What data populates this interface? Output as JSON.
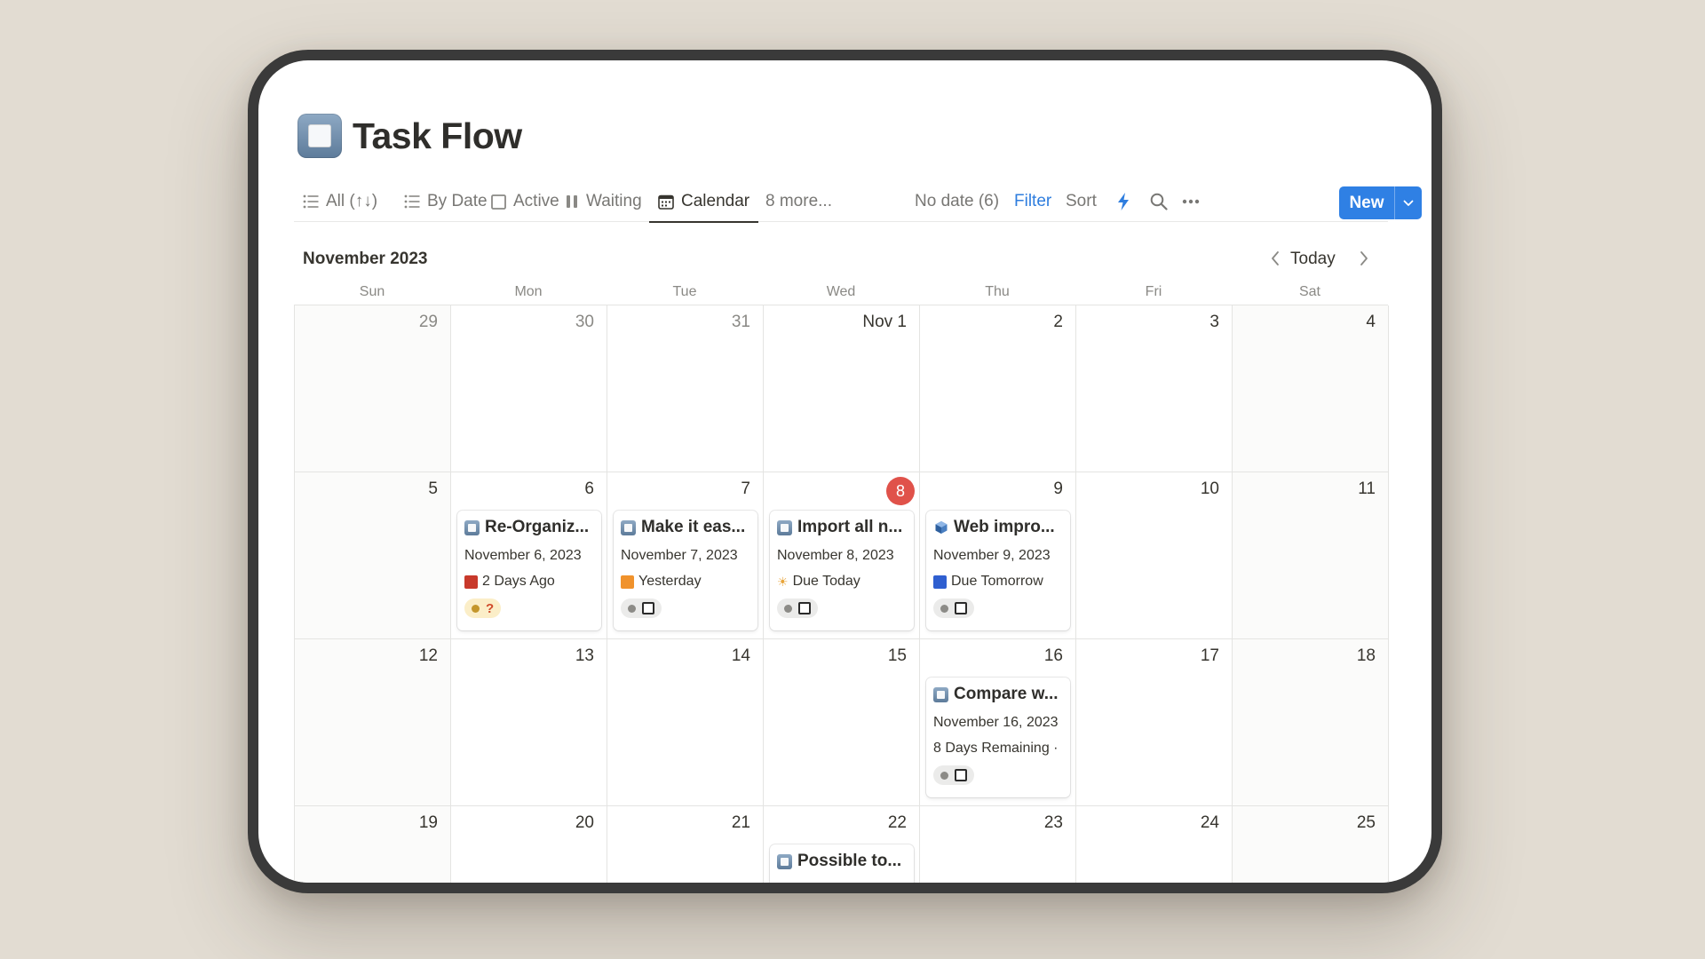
{
  "page": {
    "title": "Task Flow",
    "icon": "stop-button-icon"
  },
  "views": [
    {
      "label": "All (↑↓)",
      "icon": "list-icon"
    },
    {
      "label": "By Date",
      "icon": "list-icon"
    },
    {
      "label": "Active",
      "icon": "checkbox-icon"
    },
    {
      "label": "Waiting",
      "icon": "pause-icon"
    },
    {
      "label": "Calendar",
      "icon": "calendar-icon",
      "active": true
    },
    {
      "label": "8 more...",
      "icon": ""
    }
  ],
  "toolbar": {
    "no_date": "No date (6)",
    "filter": "Filter",
    "sort": "Sort",
    "automation_icon": "lightning-icon",
    "search_icon": "search-icon",
    "more_icon": "more-icon",
    "new_label": "New",
    "accent_color": "#2f80e4"
  },
  "calendar": {
    "month_label": "November 2023",
    "today_label": "Today",
    "weekdays": [
      "Sun",
      "Mon",
      "Tue",
      "Wed",
      "Thu",
      "Fri",
      "Sat"
    ],
    "today_color": "#e0524a",
    "weeks": [
      [
        "29",
        "30",
        "31",
        "Nov 1",
        "2",
        "3",
        "4"
      ],
      [
        "5",
        "6",
        "7",
        "8",
        "9",
        "10",
        "11"
      ],
      [
        "12",
        "13",
        "14",
        "15",
        "16",
        "17",
        "18"
      ],
      [
        "19",
        "20",
        "21",
        "22",
        "23",
        "24",
        "25"
      ]
    ],
    "muted_days": [
      "29",
      "30",
      "31"
    ],
    "today": "8"
  },
  "tasks": {
    "nov6": {
      "title": "Re-Organiz...",
      "date": "November 6, 2023",
      "status": "2 Days Ago",
      "status_color": "#c8392b",
      "pill": "?"
    },
    "nov7": {
      "title": "Make it eas...",
      "date": "November 7, 2023",
      "status": "Yesterday",
      "status_color": "#f0922c"
    },
    "nov8": {
      "title": "Import all n...",
      "date": "November 8, 2023",
      "status": "Due Today",
      "status_icon": "sun-icon"
    },
    "nov9": {
      "title": "Web impro...",
      "date": "November 9, 2023",
      "status": "Due Tomorrow",
      "status_color": "#2f5fd0"
    },
    "nov16": {
      "title": "Compare w...",
      "date": "November 16, 2023",
      "status": "8 Days Remaining ·"
    },
    "nov22": {
      "title": "Possible to..."
    }
  }
}
